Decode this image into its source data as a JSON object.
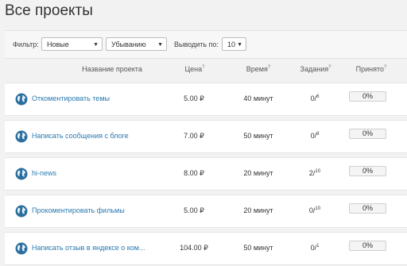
{
  "page": {
    "title": "Все проекты"
  },
  "filters": {
    "filter_label": "Фильтр:",
    "filter_value": "Новые",
    "order_value": "Убыванию",
    "per_page_label": "Выводить по:",
    "per_page_value": "10"
  },
  "table": {
    "headers": {
      "name": "Название проекта",
      "price": "Цена",
      "price_mark": "?",
      "time": "Время",
      "time_mark": "?",
      "tasks": "Задания",
      "tasks_mark": "?",
      "accepted": "Принято",
      "accepted_mark": "?"
    },
    "rows": [
      {
        "name": "Откоментировать темы",
        "price": "5.00 ₽",
        "time": "40 минут",
        "tasks_done": "0/",
        "tasks_total": "6",
        "accepted": "0%"
      },
      {
        "name": "Написать сообщения с блоге",
        "price": "7.00 ₽",
        "time": "50 минут",
        "tasks_done": "0/",
        "tasks_total": "8",
        "accepted": "0%"
      },
      {
        "name": "hi-news",
        "price": "8.00 ₽",
        "time": "20 минут",
        "tasks_done": "2/",
        "tasks_total": "10",
        "accepted": "0%"
      },
      {
        "name": "Прокоментировать фильмы",
        "price": "5.00 ₽",
        "time": "20 минут",
        "tasks_done": "0/",
        "tasks_total": "10",
        "accepted": "0%"
      },
      {
        "name": "Написать отзыв в яндексе о ком...",
        "price": "104.00 ₽",
        "time": "50 минут",
        "tasks_done": "0/",
        "tasks_total": "1",
        "accepted": "0%"
      }
    ]
  },
  "icons": {
    "row_icon": "globe-icon",
    "select_caret": "caret-down-icon"
  },
  "colors": {
    "link": "#2a7ab0",
    "globe": "#2c6f9e",
    "background": "#f2f2f2"
  }
}
